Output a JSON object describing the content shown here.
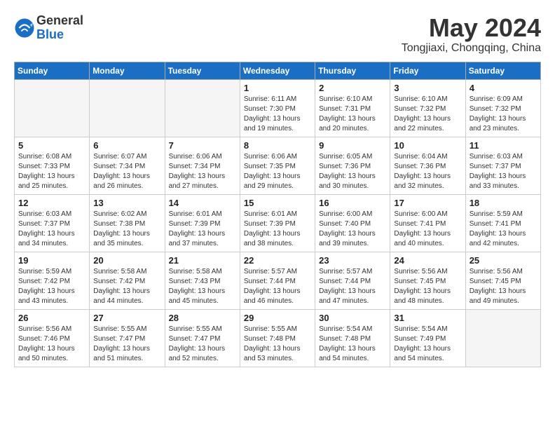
{
  "logo": {
    "general": "General",
    "blue": "Blue"
  },
  "title": "May 2024",
  "subtitle": "Tongjiaxi, Chongqing, China",
  "headers": [
    "Sunday",
    "Monday",
    "Tuesday",
    "Wednesday",
    "Thursday",
    "Friday",
    "Saturday"
  ],
  "weeks": [
    [
      {
        "day": "",
        "sunrise": "",
        "sunset": "",
        "daylight": "",
        "empty": true
      },
      {
        "day": "",
        "sunrise": "",
        "sunset": "",
        "daylight": "",
        "empty": true
      },
      {
        "day": "",
        "sunrise": "",
        "sunset": "",
        "daylight": "",
        "empty": true
      },
      {
        "day": "1",
        "sunrise": "Sunrise: 6:11 AM",
        "sunset": "Sunset: 7:30 PM",
        "daylight": "Daylight: 13 hours and 19 minutes."
      },
      {
        "day": "2",
        "sunrise": "Sunrise: 6:10 AM",
        "sunset": "Sunset: 7:31 PM",
        "daylight": "Daylight: 13 hours and 20 minutes."
      },
      {
        "day": "3",
        "sunrise": "Sunrise: 6:10 AM",
        "sunset": "Sunset: 7:32 PM",
        "daylight": "Daylight: 13 hours and 22 minutes."
      },
      {
        "day": "4",
        "sunrise": "Sunrise: 6:09 AM",
        "sunset": "Sunset: 7:32 PM",
        "daylight": "Daylight: 13 hours and 23 minutes."
      }
    ],
    [
      {
        "day": "5",
        "sunrise": "Sunrise: 6:08 AM",
        "sunset": "Sunset: 7:33 PM",
        "daylight": "Daylight: 13 hours and 25 minutes."
      },
      {
        "day": "6",
        "sunrise": "Sunrise: 6:07 AM",
        "sunset": "Sunset: 7:34 PM",
        "daylight": "Daylight: 13 hours and 26 minutes."
      },
      {
        "day": "7",
        "sunrise": "Sunrise: 6:06 AM",
        "sunset": "Sunset: 7:34 PM",
        "daylight": "Daylight: 13 hours and 27 minutes."
      },
      {
        "day": "8",
        "sunrise": "Sunrise: 6:06 AM",
        "sunset": "Sunset: 7:35 PM",
        "daylight": "Daylight: 13 hours and 29 minutes."
      },
      {
        "day": "9",
        "sunrise": "Sunrise: 6:05 AM",
        "sunset": "Sunset: 7:36 PM",
        "daylight": "Daylight: 13 hours and 30 minutes."
      },
      {
        "day": "10",
        "sunrise": "Sunrise: 6:04 AM",
        "sunset": "Sunset: 7:36 PM",
        "daylight": "Daylight: 13 hours and 32 minutes."
      },
      {
        "day": "11",
        "sunrise": "Sunrise: 6:03 AM",
        "sunset": "Sunset: 7:37 PM",
        "daylight": "Daylight: 13 hours and 33 minutes."
      }
    ],
    [
      {
        "day": "12",
        "sunrise": "Sunrise: 6:03 AM",
        "sunset": "Sunset: 7:37 PM",
        "daylight": "Daylight: 13 hours and 34 minutes."
      },
      {
        "day": "13",
        "sunrise": "Sunrise: 6:02 AM",
        "sunset": "Sunset: 7:38 PM",
        "daylight": "Daylight: 13 hours and 35 minutes."
      },
      {
        "day": "14",
        "sunrise": "Sunrise: 6:01 AM",
        "sunset": "Sunset: 7:39 PM",
        "daylight": "Daylight: 13 hours and 37 minutes."
      },
      {
        "day": "15",
        "sunrise": "Sunrise: 6:01 AM",
        "sunset": "Sunset: 7:39 PM",
        "daylight": "Daylight: 13 hours and 38 minutes."
      },
      {
        "day": "16",
        "sunrise": "Sunrise: 6:00 AM",
        "sunset": "Sunset: 7:40 PM",
        "daylight": "Daylight: 13 hours and 39 minutes."
      },
      {
        "day": "17",
        "sunrise": "Sunrise: 6:00 AM",
        "sunset": "Sunset: 7:41 PM",
        "daylight": "Daylight: 13 hours and 40 minutes."
      },
      {
        "day": "18",
        "sunrise": "Sunrise: 5:59 AM",
        "sunset": "Sunset: 7:41 PM",
        "daylight": "Daylight: 13 hours and 42 minutes."
      }
    ],
    [
      {
        "day": "19",
        "sunrise": "Sunrise: 5:59 AM",
        "sunset": "Sunset: 7:42 PM",
        "daylight": "Daylight: 13 hours and 43 minutes."
      },
      {
        "day": "20",
        "sunrise": "Sunrise: 5:58 AM",
        "sunset": "Sunset: 7:42 PM",
        "daylight": "Daylight: 13 hours and 44 minutes."
      },
      {
        "day": "21",
        "sunrise": "Sunrise: 5:58 AM",
        "sunset": "Sunset: 7:43 PM",
        "daylight": "Daylight: 13 hours and 45 minutes."
      },
      {
        "day": "22",
        "sunrise": "Sunrise: 5:57 AM",
        "sunset": "Sunset: 7:44 PM",
        "daylight": "Daylight: 13 hours and 46 minutes."
      },
      {
        "day": "23",
        "sunrise": "Sunrise: 5:57 AM",
        "sunset": "Sunset: 7:44 PM",
        "daylight": "Daylight: 13 hours and 47 minutes."
      },
      {
        "day": "24",
        "sunrise": "Sunrise: 5:56 AM",
        "sunset": "Sunset: 7:45 PM",
        "daylight": "Daylight: 13 hours and 48 minutes."
      },
      {
        "day": "25",
        "sunrise": "Sunrise: 5:56 AM",
        "sunset": "Sunset: 7:45 PM",
        "daylight": "Daylight: 13 hours and 49 minutes."
      }
    ],
    [
      {
        "day": "26",
        "sunrise": "Sunrise: 5:56 AM",
        "sunset": "Sunset: 7:46 PM",
        "daylight": "Daylight: 13 hours and 50 minutes."
      },
      {
        "day": "27",
        "sunrise": "Sunrise: 5:55 AM",
        "sunset": "Sunset: 7:47 PM",
        "daylight": "Daylight: 13 hours and 51 minutes."
      },
      {
        "day": "28",
        "sunrise": "Sunrise: 5:55 AM",
        "sunset": "Sunset: 7:47 PM",
        "daylight": "Daylight: 13 hours and 52 minutes."
      },
      {
        "day": "29",
        "sunrise": "Sunrise: 5:55 AM",
        "sunset": "Sunset: 7:48 PM",
        "daylight": "Daylight: 13 hours and 53 minutes."
      },
      {
        "day": "30",
        "sunrise": "Sunrise: 5:54 AM",
        "sunset": "Sunset: 7:48 PM",
        "daylight": "Daylight: 13 hours and 54 minutes."
      },
      {
        "day": "31",
        "sunrise": "Sunrise: 5:54 AM",
        "sunset": "Sunset: 7:49 PM",
        "daylight": "Daylight: 13 hours and 54 minutes."
      },
      {
        "day": "",
        "sunrise": "",
        "sunset": "",
        "daylight": "",
        "empty": true
      }
    ]
  ]
}
